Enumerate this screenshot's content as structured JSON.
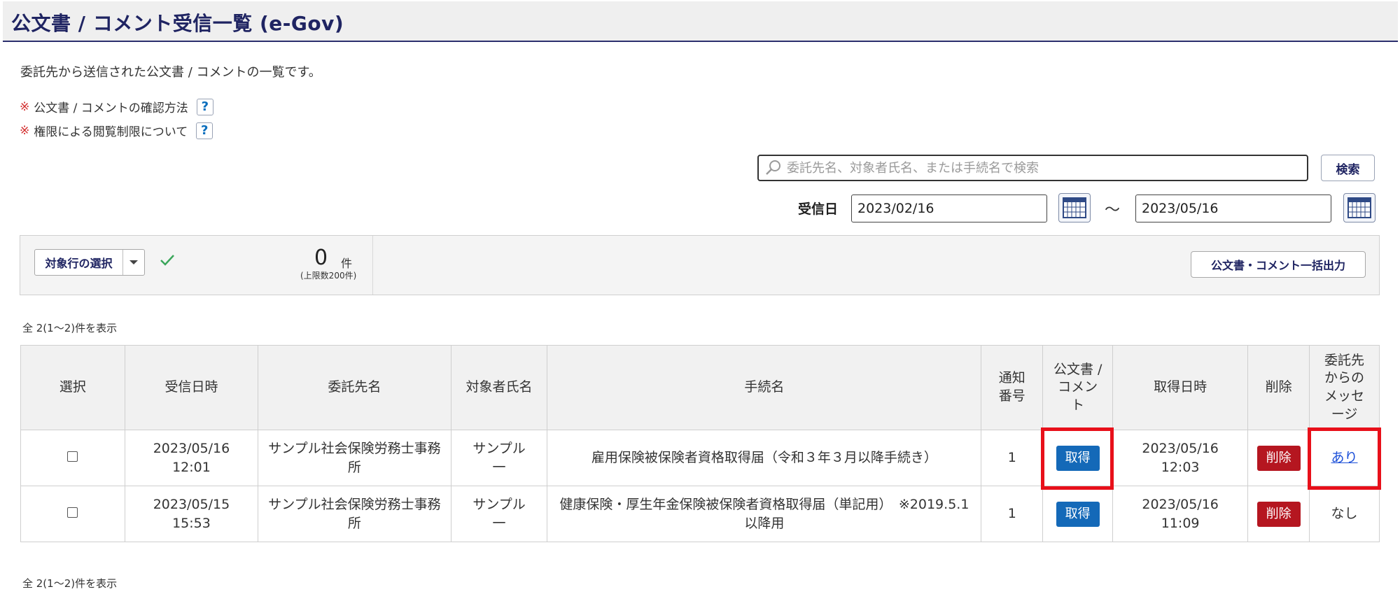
{
  "header": {
    "title": "公文書 / コメント受信一覧 (e-Gov)"
  },
  "intro": "委託先から送信された公文書 / コメントの一覧です。",
  "notes": [
    {
      "mark": "※",
      "text": "公文書 / コメントの確認方法",
      "help": "?"
    },
    {
      "mark": "※",
      "text": "権限による閲覧制限について",
      "help": "?"
    }
  ],
  "search": {
    "placeholder": "委託先名、対象者氏名、または手続名で検索",
    "value": "",
    "button_label": "検索"
  },
  "date_filter": {
    "label": "受信日",
    "from": "2023/02/16",
    "separator": "～",
    "to": "2023/05/16"
  },
  "toolbar": {
    "select_label": "対象行の選択",
    "count": "0",
    "count_unit": "件",
    "count_limit": "(上限数200件)",
    "bulk_button": "公文書・コメント一括出力"
  },
  "summary": "全 2(1～2)件を表示",
  "table": {
    "columns": [
      "選択",
      "受信日時",
      "委託先名",
      "対象者氏名",
      "手続名",
      "通知番号",
      "公文書 / コメント",
      "取得日時",
      "削除",
      "委託先からのメッセージ"
    ],
    "rows": [
      {
        "received": "2023/05/16 12:01",
        "client": "サンプル社会保険労務士事務所",
        "subject": "サンプル一",
        "procedure": "雇用保険被保険者資格取得届（令和３年３月以降手続き）",
        "notice_no": "1",
        "get_label": "取得",
        "acquired": "2023/05/16 12:03",
        "delete_label": "削除",
        "message": "あり"
      },
      {
        "received": "2023/05/15 15:53",
        "client": "サンプル社会保険労務士事務所",
        "subject": "サンプル一",
        "procedure": "健康保険・厚生年金保険被保険者資格取得届（単記用）　※2019.5.1以降用",
        "notice_no": "1",
        "get_label": "取得",
        "acquired": "2023/05/16 11:09",
        "delete_label": "削除",
        "message": "なし"
      }
    ]
  },
  "colors": {
    "header_text": "#1f2462",
    "get_button": "#1469b8",
    "delete_button": "#b51620",
    "highlight": "#e8101a",
    "link": "#1a4ed8"
  }
}
